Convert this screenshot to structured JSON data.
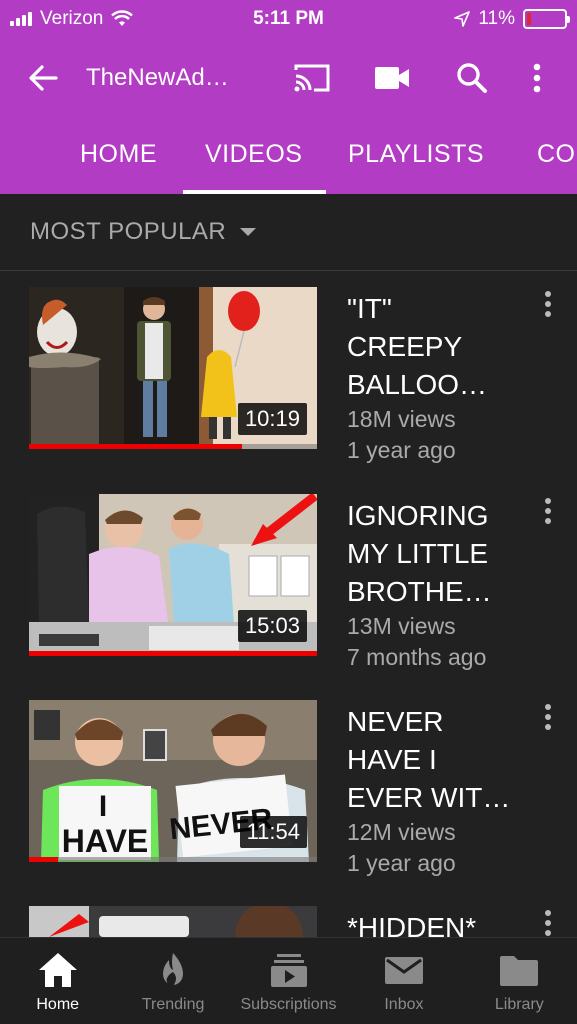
{
  "status_bar": {
    "carrier": "Verizon",
    "time": "5:11 PM",
    "battery": "11%"
  },
  "app_bar": {
    "channel_title": "TheNewAd…"
  },
  "tabs": [
    {
      "label": "HOME"
    },
    {
      "label": "VIDEOS"
    },
    {
      "label": "PLAYLISTS"
    },
    {
      "label": "CO"
    }
  ],
  "active_tab": "VIDEOS",
  "sort": {
    "label": "MOST POPULAR"
  },
  "videos": [
    {
      "title_lines": [
        "\"IT\"",
        "CREEPY",
        "BALLOO…"
      ],
      "views": "18M views",
      "age": "1 year ago",
      "duration": "10:19",
      "watched_fraction": 0.74
    },
    {
      "title_lines": [
        "IGNORING",
        "MY LITTLE",
        "BROTHE…"
      ],
      "views": "13M views",
      "age": "7 months ago",
      "duration": "15:03",
      "watched_fraction": 1.0
    },
    {
      "title_lines": [
        "NEVER",
        "HAVE I",
        "EVER WIT…"
      ],
      "views": "12M views",
      "age": "1 year ago",
      "duration": "11:54",
      "watched_fraction": 0.1,
      "thumb_text": [
        "I",
        "HAVE",
        "NEVER"
      ]
    },
    {
      "title_lines": [
        "*HIDDEN*"
      ]
    }
  ],
  "bottom_nav": [
    {
      "label": "Home",
      "icon": "home-icon",
      "active": true
    },
    {
      "label": "Trending",
      "icon": "flame-icon"
    },
    {
      "label": "Subscriptions",
      "icon": "subscriptions-icon"
    },
    {
      "label": "Inbox",
      "icon": "mail-icon"
    },
    {
      "label": "Library",
      "icon": "folder-icon"
    }
  ],
  "colors": {
    "brand": "#b23cc4",
    "background": "#212121",
    "progress": "#e00000"
  }
}
